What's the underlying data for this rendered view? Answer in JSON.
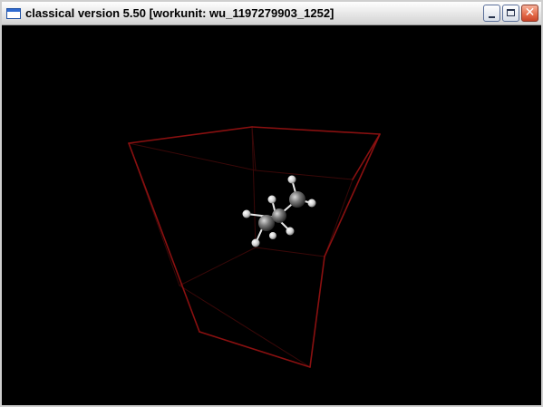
{
  "window": {
    "title": "classical version 5.50 [workunit: wu_1197279903_1252]",
    "icon": "app-window-icon"
  },
  "controls": {
    "minimize_icon": "minimize-icon",
    "maximize_icon": "maximize-icon",
    "close_icon": "close-icon",
    "close_glyph": "✕"
  },
  "scene": {
    "background": "#000000",
    "box_color": "#8a1010",
    "molecule": "ethane-like: 2 carbon atoms (gray), 6 hydrogen atoms (white)"
  }
}
